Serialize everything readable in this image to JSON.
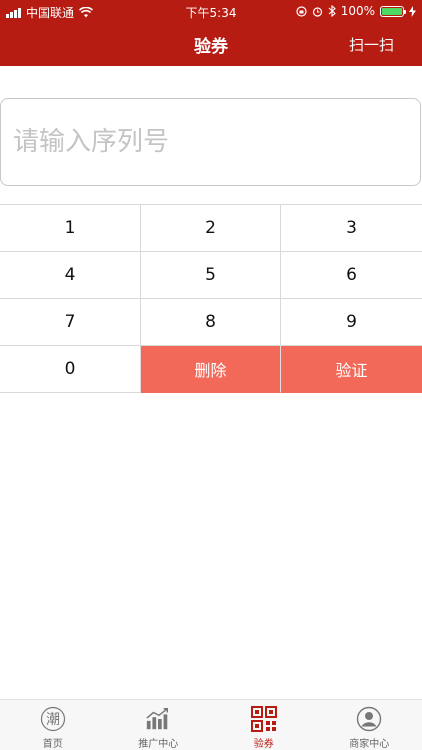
{
  "status": {
    "carrier": "中国联通",
    "time": "下午5:34",
    "battery": "100%"
  },
  "nav": {
    "title": "验券",
    "action": "扫一扫"
  },
  "input": {
    "placeholder": "请输入序列号",
    "value": ""
  },
  "keypad": {
    "k1": "1",
    "k2": "2",
    "k3": "3",
    "k4": "4",
    "k5": "5",
    "k6": "6",
    "k7": "7",
    "k8": "8",
    "k9": "9",
    "k0": "0",
    "delete": "删除",
    "verify": "验证"
  },
  "tabs": {
    "home": "首页",
    "home_glyph": "潮",
    "promo": "推广中心",
    "voucher": "验券",
    "merchant": "商家中心"
  },
  "colors": {
    "brand": "#b71c12",
    "action": "#f2695a"
  }
}
